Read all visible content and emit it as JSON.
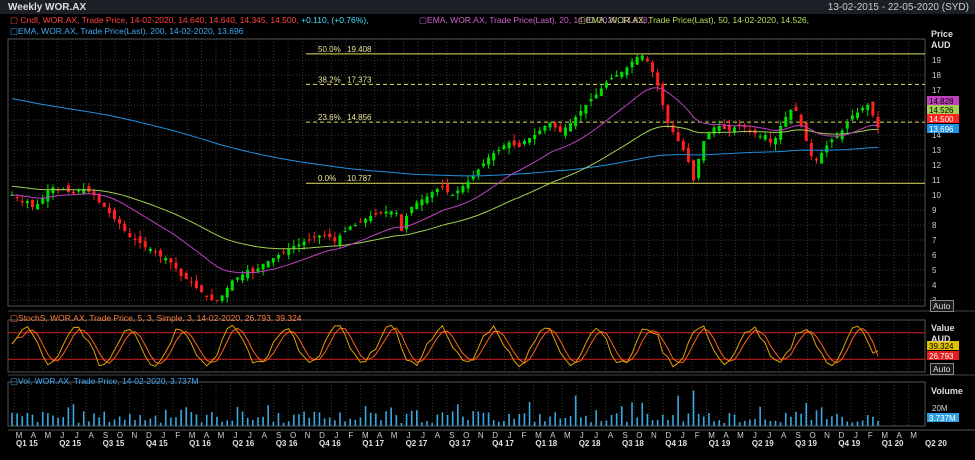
{
  "header": {
    "title": "Weekly WOR.AX",
    "date_range": "13-02-2015 - 22-05-2020 (SYD)"
  },
  "legends": {
    "price_symbol": "Cndl, WOR.AX, Trade Price, 14-02-2020, 14.640, 14.640, 14.345, 14.500,",
    "price_change": "+0.110, (+0.76%),",
    "ema20": "EMA, WOR.AX, Trade Price(Last), 20, 14-02-2020, 14.828,",
    "ema50": "EMA, WOR.AX, Trade Price(Last), 50, 14-02-2020, 14.526,",
    "ema200": "EMA, WOR.AX, Trade Price(Last), 200, 14-02-2020, 13.696",
    "stoch": "StochS, WOR.AX, Trade Price, 5, 3, Simple, 3, 14-02-2020, 26.793, 39.324",
    "vol": "Vol, WOR.AX, Trade Price, 14-02-2020, 3.737M"
  },
  "axes": {
    "price_title": "Price",
    "price_unit": "AUD",
    "stoch_title": "Value",
    "stoch_unit": "AUD",
    "vol_title": "Volume",
    "auto_label": "Auto",
    "vol_tick": "20M"
  },
  "colors": {
    "up": "#00e000",
    "down": "#ff2020",
    "ema20": "#c040c0",
    "ema50": "#a0d050",
    "ema200": "#2090e0",
    "stoch_k": "#e0a000",
    "stoch_d": "#ff6020",
    "fib": "#e0e060",
    "volume": "#38a8e0",
    "grid": "#3a3a3a"
  },
  "chart_data": [
    {
      "type": "candlestick",
      "panel": "price",
      "y_axis": "AUD",
      "ylim": [
        3,
        20
      ],
      "yticks": [
        3,
        4,
        5,
        6,
        7,
        8,
        9,
        10,
        11,
        12,
        13,
        14,
        15,
        16,
        17,
        18,
        19
      ],
      "x_start": "2015-02-13",
      "x_end": "2020-05-22",
      "month_ticks": [
        "M",
        "A",
        "M",
        "J",
        "J",
        "A",
        "S",
        "O",
        "N",
        "D",
        "J",
        "F",
        "M",
        "A",
        "M",
        "J",
        "J",
        "A",
        "S",
        "O",
        "N",
        "D",
        "J",
        "F",
        "M",
        "A",
        "M",
        "J",
        "J",
        "A",
        "S",
        "O",
        "N",
        "D",
        "J",
        "F",
        "M",
        "A",
        "M",
        "J",
        "J",
        "A",
        "S",
        "O",
        "N",
        "D",
        "J",
        "F",
        "M",
        "A",
        "M",
        "J",
        "J",
        "A",
        "S",
        "O",
        "N",
        "D",
        "J",
        "F",
        "M",
        "A",
        "M"
      ],
      "quarter_ticks": [
        "Q1 15",
        "Q2 15",
        "Q3 15",
        "Q4 15",
        "Q1 16",
        "Q2 16",
        "Q3 16",
        "Q4 16",
        "Q1 17",
        "Q2 17",
        "Q3 17",
        "Q4 17",
        "Q1 18",
        "Q2 18",
        "Q3 18",
        "Q4 18",
        "Q1 19",
        "Q2 19",
        "Q3 19",
        "Q4 19",
        "Q1 20",
        "Q2 20"
      ],
      "weekly_close_approx": [
        10.0,
        9.8,
        9.5,
        9.6,
        9.2,
        9.4,
        9.8,
        10.3,
        10.5,
        10.3,
        10.4,
        10.2,
        10.1,
        10.3,
        10.4,
        10.2,
        10.0,
        9.5,
        9.2,
        8.8,
        8.4,
        8.1,
        7.6,
        7.2,
        7.0,
        6.8,
        6.5,
        6.4,
        6.2,
        5.9,
        5.8,
        5.5,
        5.1,
        4.6,
        4.4,
        4.2,
        3.8,
        3.5,
        3.2,
        3.0,
        2.95,
        3.3,
        3.8,
        4.3,
        4.5,
        4.7,
        5.0,
        4.8,
        5.1,
        5.4,
        5.6,
        5.8,
        6.0,
        6.2,
        6.4,
        6.6,
        6.7,
        6.9,
        7.0,
        7.2,
        7.3,
        7.3,
        7.2,
        6.9,
        7.3,
        7.6,
        7.9,
        8.0,
        8.2,
        8.4,
        8.6,
        8.7,
        8.8,
        8.9,
        8.9,
        8.8,
        7.6,
        8.6,
        9.2,
        9.5,
        9.7,
        9.9,
        10.2,
        10.4,
        10.5,
        10.2,
        10.0,
        10.3,
        10.6,
        10.9,
        11.3,
        11.7,
        12.1,
        12.5,
        12.8,
        13.0,
        13.3,
        13.5,
        13.3,
        13.2,
        13.6,
        13.8,
        14.0,
        14.3,
        14.6,
        14.8,
        14.5,
        14.2,
        14.5,
        14.8,
        15.2,
        15.6,
        16.0,
        16.4,
        16.7,
        17.1,
        17.5,
        17.8,
        18.0,
        18.2,
        18.5,
        18.9,
        19.2,
        19.3,
        18.9,
        18.2,
        17.3,
        16.0,
        14.8,
        14.2,
        13.6,
        13.0,
        12.2,
        11.0,
        12.4,
        13.6,
        14.1,
        14.5,
        14.6,
        14.4,
        14.3,
        14.5,
        14.7,
        14.5,
        14.3,
        14.1,
        13.9,
        14.0,
        13.5,
        13.8,
        14.6,
        15.2,
        15.7,
        15.6,
        14.6,
        13.6,
        12.6,
        12.3,
        12.8,
        13.3,
        13.7,
        13.9,
        14.3,
        14.8,
        15.3,
        15.5,
        15.8,
        16.0,
        15.3,
        14.5
      ],
      "series": [
        {
          "name": "EMA 20",
          "last": 14.828
        },
        {
          "name": "EMA 50",
          "last": 14.526
        },
        {
          "name": "EMA 200",
          "last": 13.696
        }
      ],
      "last_price": 14.5,
      "fib_levels": [
        {
          "label": "50.0%",
          "price": "19.408",
          "value": 19.408
        },
        {
          "label": "38.2%",
          "price": "17.373",
          "value": 17.373
        },
        {
          "label": "23.6%",
          "price": "14.856",
          "value": 14.856
        },
        {
          "label": "0.0%",
          "price": "10.787",
          "value": 10.787
        }
      ],
      "price_tags": [
        "14.828",
        "14.526",
        "14.500",
        "13.696"
      ]
    },
    {
      "type": "line",
      "panel": "stochastic",
      "ylim": [
        0,
        100
      ],
      "series": [
        {
          "name": "%K",
          "last": 39.324
        },
        {
          "name": "%D",
          "last": 26.793
        }
      ],
      "upper_band": 80,
      "lower_band": 20,
      "value_tags": [
        "39.324",
        "26.793"
      ]
    },
    {
      "type": "bar",
      "panel": "volume",
      "last": "3.737M",
      "value_tag": "3.737M"
    }
  ]
}
